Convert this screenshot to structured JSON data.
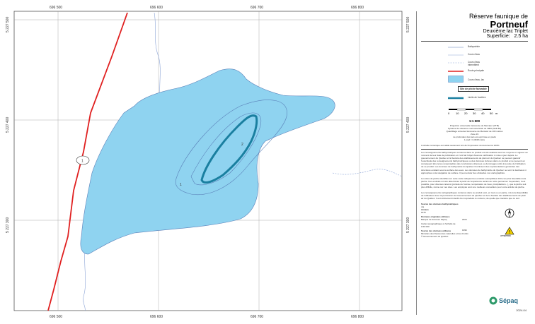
{
  "map": {
    "x_coords": [
      "696 500",
      "696 600",
      "696 700",
      "696 800"
    ],
    "y_coords": [
      "5 227 300",
      "5 227 400",
      "5 227 500"
    ],
    "road_shield": "1",
    "depth_labels": [
      "1",
      "2"
    ],
    "colors": {
      "water": "#8fd3f0",
      "road": "#e02020",
      "zone": "#1a7fa0",
      "contour": "#5a7fb8"
    }
  },
  "title": {
    "reserve": "Réserve faunique de",
    "name": "Portneuf",
    "lake": "Deuxième lac Triplet",
    "area_label": "Superficie:",
    "area_value": "2.5 ha"
  },
  "legend": [
    {
      "label": "Bathymétrie",
      "icon": "thin-line"
    },
    {
      "label": "Cours d'eau",
      "icon": "thin-line"
    },
    {
      "label": "Cours d'eau intermittent",
      "icon": "dashed-line"
    },
    {
      "label": "Route principale",
      "icon": "red-line"
    },
    {
      "label": "Cours d'eau, lac",
      "icon": "water-box"
    },
    {
      "label": "Site de pêche favorable",
      "icon": "label-box"
    },
    {
      "label": "Limite de frontière",
      "icon": "thick-line"
    }
  ],
  "scale": {
    "ticks": [
      "0",
      "10",
      "20",
      "30",
      "40",
      "50"
    ],
    "unit": "m",
    "ratio": "1:1 500"
  },
  "projection_lines": [
    "Projection universelle transverse de Mercator (UTM)",
    "Système de référence nord-américain de 1983 (NAD 83)",
    "Quadrillage universel transverse de Mercator de 100 mètres",
    "Zone 19",
    "La profondeur des lacs est exprimée en pieds",
    "1 pied = 0,3048 mètre"
  ],
  "scale_note": "L'échelle numérique est valide seulement lors de l'impression du document à 100%",
  "paragraphs": [
    "Les renseignements bathymétriques contenus dans ce produit ont été réalisés avec les moyens en vigueur au moment de leur date de publication et n'ont fait l'objet d'aucune vérification ni mise à jour depuis. Le gouvernement du Québec et la Société des établissements de plein air du Québec ne peuvent garantir l'exactitude des renseignements bathymétriques ou des données incluses dans ce produit et ne peuvent en conséquent être tenus responsables des conclusions obtenues ou dommages subis à la suite de l'utilisation de ce produit. Les données de bathymétrie du Québec fournissent des représentations générales des structures existant sous la surface des eaux. Les données de bathymétrie du Québec ne sont ni destinées ni appropriées à la navigation de surface. Il peut exister des obstacles non cartographiés.",
    "Les sites de pêche identifiés sur cette carte indiquent les endroits susceptibles d'être les plus favorables à la pêche. Ces endroits ont été déterminés à partir de l'expérience terrain de notre personnel. Cependant, il est possible, pour diverses raisons (période de l'année, température de l'eau, précipitations...), que la pêche soit plus difficile, même sur ces sites. Les employés sont une meilleure conseillers pour votre activité de pêche.",
    "Les renseignements cartographiques contenus dans ce produit sont, en tout ou en partie, mis à la disponibilité de l'utilisateur avec la permission du Gouvernement du Québec et de la Société des établissements de plein air du Québec. Il est strictement interdit d'en reproduire le contenu, de quelle que manière que ce soit."
  ],
  "sources": [
    {
      "title": "Source des données bathymétriques",
      "lines": [
        "n/a"
      ]
    },
    {
      "title": "Années",
      "lines": [
        "1975"
      ]
    },
    {
      "title": "Données originales utilisées",
      "lines": [
        "Banque de données Sépaq",
        "Cartes topographiques à l'échelle de 1/20 000"
      ]
    },
    {
      "title": "Source des données utilisées",
      "lines": [
        "Ministère des Ressources naturelles et des Forêts",
        "© Gouvernement du Québec"
      ]
    }
  ],
  "source_years": [
    "2024",
    "1996"
  ],
  "logo": "Sépaq",
  "warning": "ATTENTION",
  "code": "2024-04"
}
